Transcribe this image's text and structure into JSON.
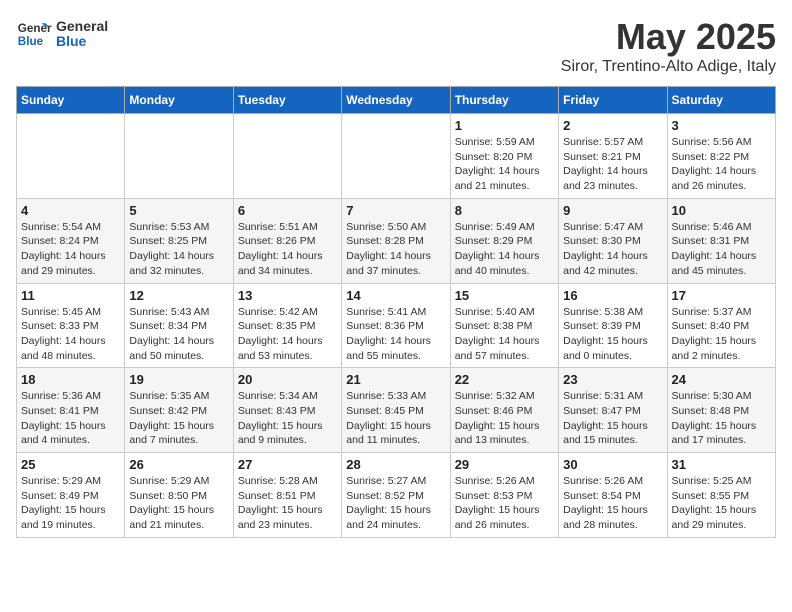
{
  "header": {
    "logo_general": "General",
    "logo_blue": "Blue",
    "title": "May 2025",
    "subtitle": "Siror, Trentino-Alto Adige, Italy"
  },
  "days_of_week": [
    "Sunday",
    "Monday",
    "Tuesday",
    "Wednesday",
    "Thursday",
    "Friday",
    "Saturday"
  ],
  "weeks": [
    [
      {
        "num": "",
        "detail": ""
      },
      {
        "num": "",
        "detail": ""
      },
      {
        "num": "",
        "detail": ""
      },
      {
        "num": "",
        "detail": ""
      },
      {
        "num": "1",
        "detail": "Sunrise: 5:59 AM\nSunset: 8:20 PM\nDaylight: 14 hours and 21 minutes."
      },
      {
        "num": "2",
        "detail": "Sunrise: 5:57 AM\nSunset: 8:21 PM\nDaylight: 14 hours and 23 minutes."
      },
      {
        "num": "3",
        "detail": "Sunrise: 5:56 AM\nSunset: 8:22 PM\nDaylight: 14 hours and 26 minutes."
      }
    ],
    [
      {
        "num": "4",
        "detail": "Sunrise: 5:54 AM\nSunset: 8:24 PM\nDaylight: 14 hours and 29 minutes."
      },
      {
        "num": "5",
        "detail": "Sunrise: 5:53 AM\nSunset: 8:25 PM\nDaylight: 14 hours and 32 minutes."
      },
      {
        "num": "6",
        "detail": "Sunrise: 5:51 AM\nSunset: 8:26 PM\nDaylight: 14 hours and 34 minutes."
      },
      {
        "num": "7",
        "detail": "Sunrise: 5:50 AM\nSunset: 8:28 PM\nDaylight: 14 hours and 37 minutes."
      },
      {
        "num": "8",
        "detail": "Sunrise: 5:49 AM\nSunset: 8:29 PM\nDaylight: 14 hours and 40 minutes."
      },
      {
        "num": "9",
        "detail": "Sunrise: 5:47 AM\nSunset: 8:30 PM\nDaylight: 14 hours and 42 minutes."
      },
      {
        "num": "10",
        "detail": "Sunrise: 5:46 AM\nSunset: 8:31 PM\nDaylight: 14 hours and 45 minutes."
      }
    ],
    [
      {
        "num": "11",
        "detail": "Sunrise: 5:45 AM\nSunset: 8:33 PM\nDaylight: 14 hours and 48 minutes."
      },
      {
        "num": "12",
        "detail": "Sunrise: 5:43 AM\nSunset: 8:34 PM\nDaylight: 14 hours and 50 minutes."
      },
      {
        "num": "13",
        "detail": "Sunrise: 5:42 AM\nSunset: 8:35 PM\nDaylight: 14 hours and 53 minutes."
      },
      {
        "num": "14",
        "detail": "Sunrise: 5:41 AM\nSunset: 8:36 PM\nDaylight: 14 hours and 55 minutes."
      },
      {
        "num": "15",
        "detail": "Sunrise: 5:40 AM\nSunset: 8:38 PM\nDaylight: 14 hours and 57 minutes."
      },
      {
        "num": "16",
        "detail": "Sunrise: 5:38 AM\nSunset: 8:39 PM\nDaylight: 15 hours and 0 minutes."
      },
      {
        "num": "17",
        "detail": "Sunrise: 5:37 AM\nSunset: 8:40 PM\nDaylight: 15 hours and 2 minutes."
      }
    ],
    [
      {
        "num": "18",
        "detail": "Sunrise: 5:36 AM\nSunset: 8:41 PM\nDaylight: 15 hours and 4 minutes."
      },
      {
        "num": "19",
        "detail": "Sunrise: 5:35 AM\nSunset: 8:42 PM\nDaylight: 15 hours and 7 minutes."
      },
      {
        "num": "20",
        "detail": "Sunrise: 5:34 AM\nSunset: 8:43 PM\nDaylight: 15 hours and 9 minutes."
      },
      {
        "num": "21",
        "detail": "Sunrise: 5:33 AM\nSunset: 8:45 PM\nDaylight: 15 hours and 11 minutes."
      },
      {
        "num": "22",
        "detail": "Sunrise: 5:32 AM\nSunset: 8:46 PM\nDaylight: 15 hours and 13 minutes."
      },
      {
        "num": "23",
        "detail": "Sunrise: 5:31 AM\nSunset: 8:47 PM\nDaylight: 15 hours and 15 minutes."
      },
      {
        "num": "24",
        "detail": "Sunrise: 5:30 AM\nSunset: 8:48 PM\nDaylight: 15 hours and 17 minutes."
      }
    ],
    [
      {
        "num": "25",
        "detail": "Sunrise: 5:29 AM\nSunset: 8:49 PM\nDaylight: 15 hours and 19 minutes."
      },
      {
        "num": "26",
        "detail": "Sunrise: 5:29 AM\nSunset: 8:50 PM\nDaylight: 15 hours and 21 minutes."
      },
      {
        "num": "27",
        "detail": "Sunrise: 5:28 AM\nSunset: 8:51 PM\nDaylight: 15 hours and 23 minutes."
      },
      {
        "num": "28",
        "detail": "Sunrise: 5:27 AM\nSunset: 8:52 PM\nDaylight: 15 hours and 24 minutes."
      },
      {
        "num": "29",
        "detail": "Sunrise: 5:26 AM\nSunset: 8:53 PM\nDaylight: 15 hours and 26 minutes."
      },
      {
        "num": "30",
        "detail": "Sunrise: 5:26 AM\nSunset: 8:54 PM\nDaylight: 15 hours and 28 minutes."
      },
      {
        "num": "31",
        "detail": "Sunrise: 5:25 AM\nSunset: 8:55 PM\nDaylight: 15 hours and 29 minutes."
      }
    ]
  ]
}
